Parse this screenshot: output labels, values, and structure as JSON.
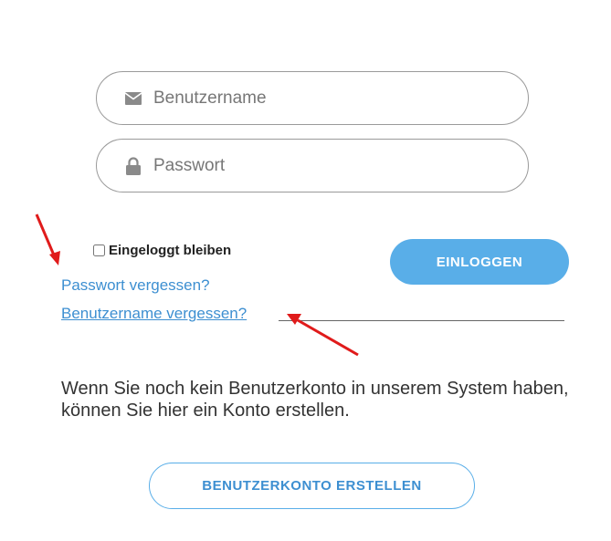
{
  "login_form": {
    "username": {
      "placeholder": "Benutzername",
      "value": "",
      "icon": "envelope-icon"
    },
    "password": {
      "placeholder": "Passwort",
      "value": "",
      "icon": "lock-icon"
    },
    "remember_label": "Eingeloggt bleiben",
    "remember_checked": false,
    "login_button": "EINLOGGEN",
    "forgot_password": "Passwort vergessen?",
    "forgot_username": "Benutzername vergessen?"
  },
  "register": {
    "text": "Wenn Sie noch kein Benutzerkonto in unserem System haben, können Sie hier ein Konto erstellen.",
    "button": "BENUTZERKONTO ERSTELLEN"
  },
  "colors": {
    "accent": "#59aee8",
    "link": "#3d8fd1",
    "annotation_arrow": "#e01b1b"
  }
}
